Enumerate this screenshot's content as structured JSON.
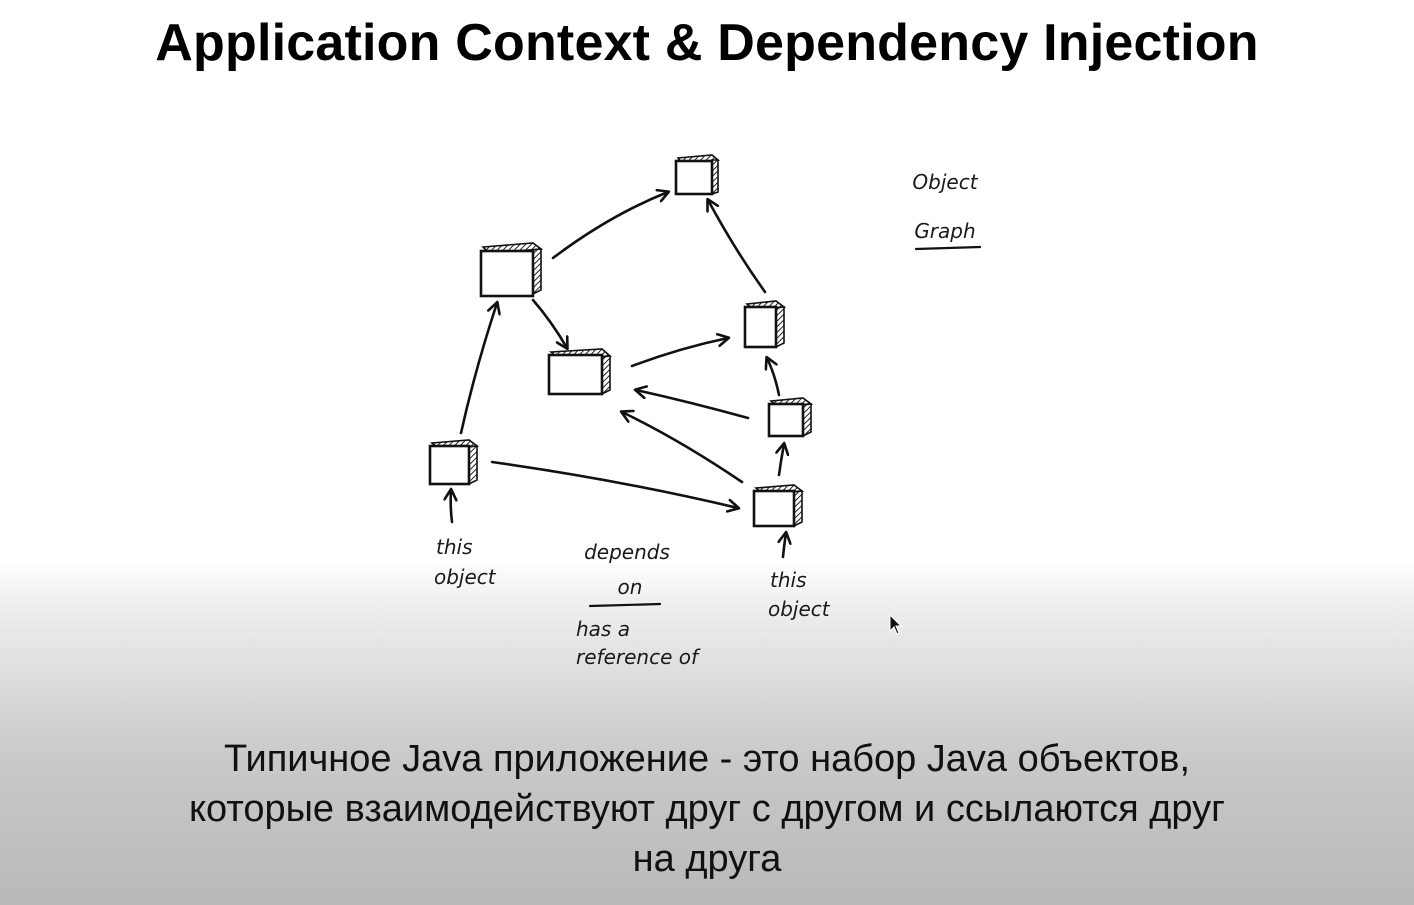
{
  "slide": {
    "title": "Application Context & Dependency Injection"
  },
  "diagram": {
    "legend_line1": "Object",
    "legend_line2": "Graph",
    "left_label_line1": "this",
    "left_label_line2": "object",
    "right_label_line1": "this",
    "right_label_line2": "object",
    "relation_line1": "depends",
    "relation_line2": "on",
    "relation_alt_line1": "has a",
    "relation_alt_line2": "reference of",
    "icons": {
      "node": "cube-box-icon",
      "cursor": "mouse-pointer-icon"
    }
  },
  "caption": {
    "line1": "Типичное Java приложение - это набор Java объектов,",
    "line2": "которые взаимодействуют друг с другом и ссылаются друг",
    "line3": "на друга"
  }
}
